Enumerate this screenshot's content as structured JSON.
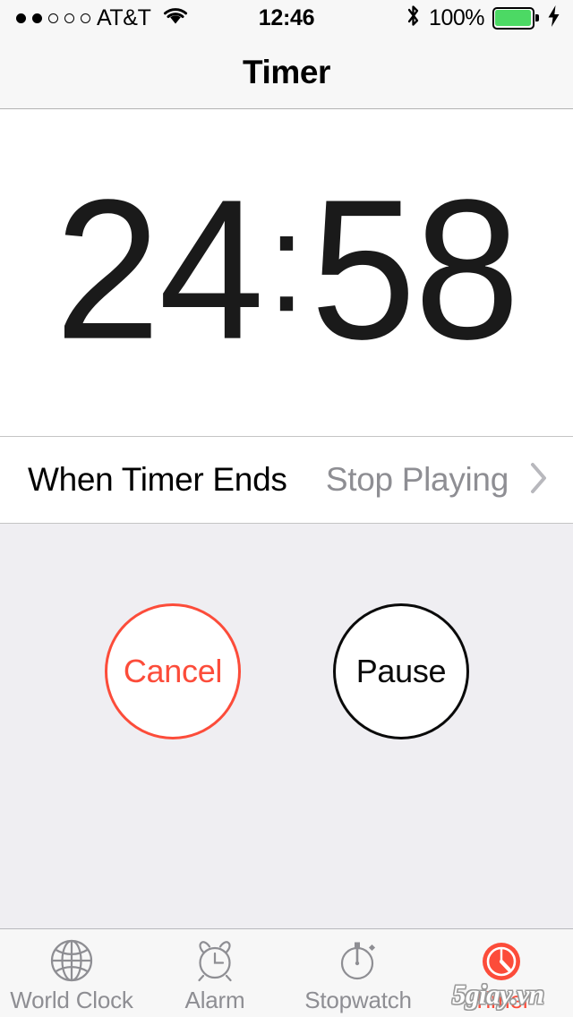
{
  "status_bar": {
    "signal_dots_total": 5,
    "signal_dots_filled": 2,
    "carrier": "AT&T",
    "wifi_icon": "wifi-icon",
    "time": "12:46",
    "bluetooth_icon": "bluetooth-icon",
    "battery_percent": "100%",
    "battery_level": 100,
    "battery_color": "#4cd964",
    "charging_icon": "lightning-bolt-icon",
    "charging": true
  },
  "navbar": {
    "title": "Timer"
  },
  "timer": {
    "minutes": "24",
    "separator": ":",
    "seconds": "58",
    "full": "24:58",
    "state": "running"
  },
  "when_timer_ends": {
    "label": "When Timer Ends",
    "value": "Stop Playing",
    "chevron_icon": "chevron-right-icon"
  },
  "controls": {
    "cancel": {
      "label": "Cancel",
      "color": "#fc4c3a"
    },
    "pause": {
      "label": "Pause",
      "color": "#0a0a0a"
    }
  },
  "tabbar": {
    "items": [
      {
        "label": "World Clock",
        "icon": "globe-icon",
        "active": false
      },
      {
        "label": "Alarm",
        "icon": "alarm-clock-icon",
        "active": false
      },
      {
        "label": "Stopwatch",
        "icon": "stopwatch-icon",
        "active": false
      },
      {
        "label": "Timer",
        "icon": "timer-icon",
        "active": true
      }
    ],
    "active_color": "#fc4c3a",
    "inactive_color": "#8e8e93"
  },
  "watermark": {
    "text": "5giay.vn"
  }
}
